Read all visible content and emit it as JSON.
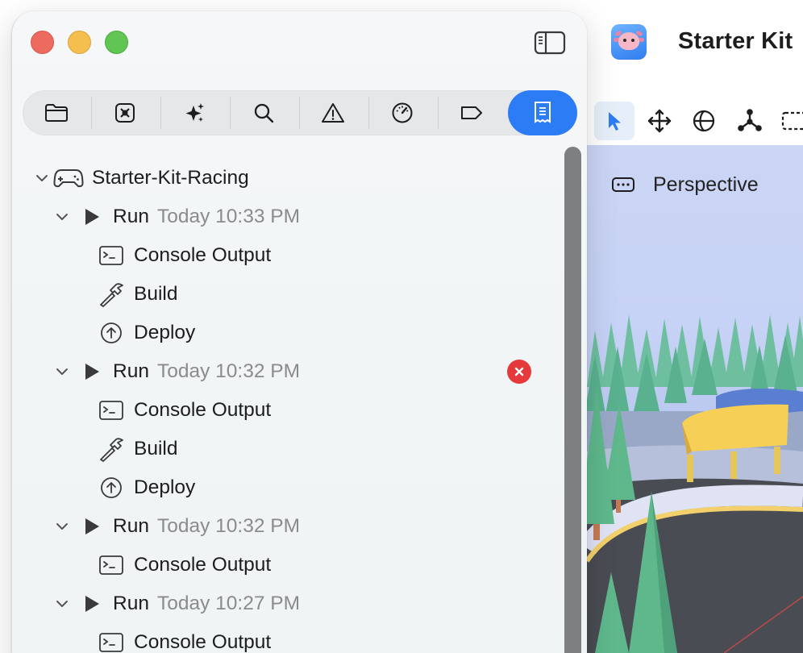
{
  "window": {
    "title": "Starter Kit",
    "traffic_lights": [
      "close",
      "minimize",
      "zoom"
    ]
  },
  "navigator": {
    "tabs": [
      {
        "name": "project-navigator",
        "icon": "folder-icon"
      },
      {
        "name": "source-control",
        "icon": "xmark-box-icon"
      },
      {
        "name": "assistant",
        "icon": "sparkles-icon"
      },
      {
        "name": "find",
        "icon": "search-icon"
      },
      {
        "name": "issues",
        "icon": "warning-icon"
      },
      {
        "name": "tests",
        "icon": "gauge-icon"
      },
      {
        "name": "breakpoints",
        "icon": "tag-icon"
      },
      {
        "name": "reports",
        "icon": "report-icon",
        "active": true
      }
    ],
    "project": "Starter-Kit-Racing",
    "runs": [
      {
        "label": "Run",
        "time": "Today 10:33 PM",
        "error": false,
        "children": [
          {
            "label": "Console Output",
            "icon": "console-icon"
          },
          {
            "label": "Build",
            "icon": "hammer-icon"
          },
          {
            "label": "Deploy",
            "icon": "upload-icon"
          }
        ]
      },
      {
        "label": "Run",
        "time": "Today 10:32 PM",
        "error": true,
        "children": [
          {
            "label": "Console Output",
            "icon": "console-icon"
          },
          {
            "label": "Build",
            "icon": "hammer-icon"
          },
          {
            "label": "Deploy",
            "icon": "upload-icon"
          }
        ]
      },
      {
        "label": "Run",
        "time": "Today 10:32 PM",
        "error": false,
        "children": [
          {
            "label": "Console Output",
            "icon": "console-icon"
          }
        ]
      },
      {
        "label": "Run",
        "time": "Today 10:27 PM",
        "error": false,
        "children": [
          {
            "label": "Console Output",
            "icon": "console-icon"
          }
        ]
      }
    ]
  },
  "editor": {
    "tools": [
      {
        "name": "select-tool",
        "icon": "pointer-icon",
        "active": true
      },
      {
        "name": "move-tool",
        "icon": "move-icon"
      },
      {
        "name": "rotate-tool",
        "icon": "globe-icon"
      },
      {
        "name": "scale-tool",
        "icon": "axes-icon"
      },
      {
        "name": "marquee-tool",
        "icon": "marquee-icon"
      }
    ],
    "view_mode": "Perspective"
  },
  "colors": {
    "accent": "#2c7cf5",
    "error": "#e5393b",
    "sky": "#c7d3f6",
    "tree": "#5fb88c"
  }
}
